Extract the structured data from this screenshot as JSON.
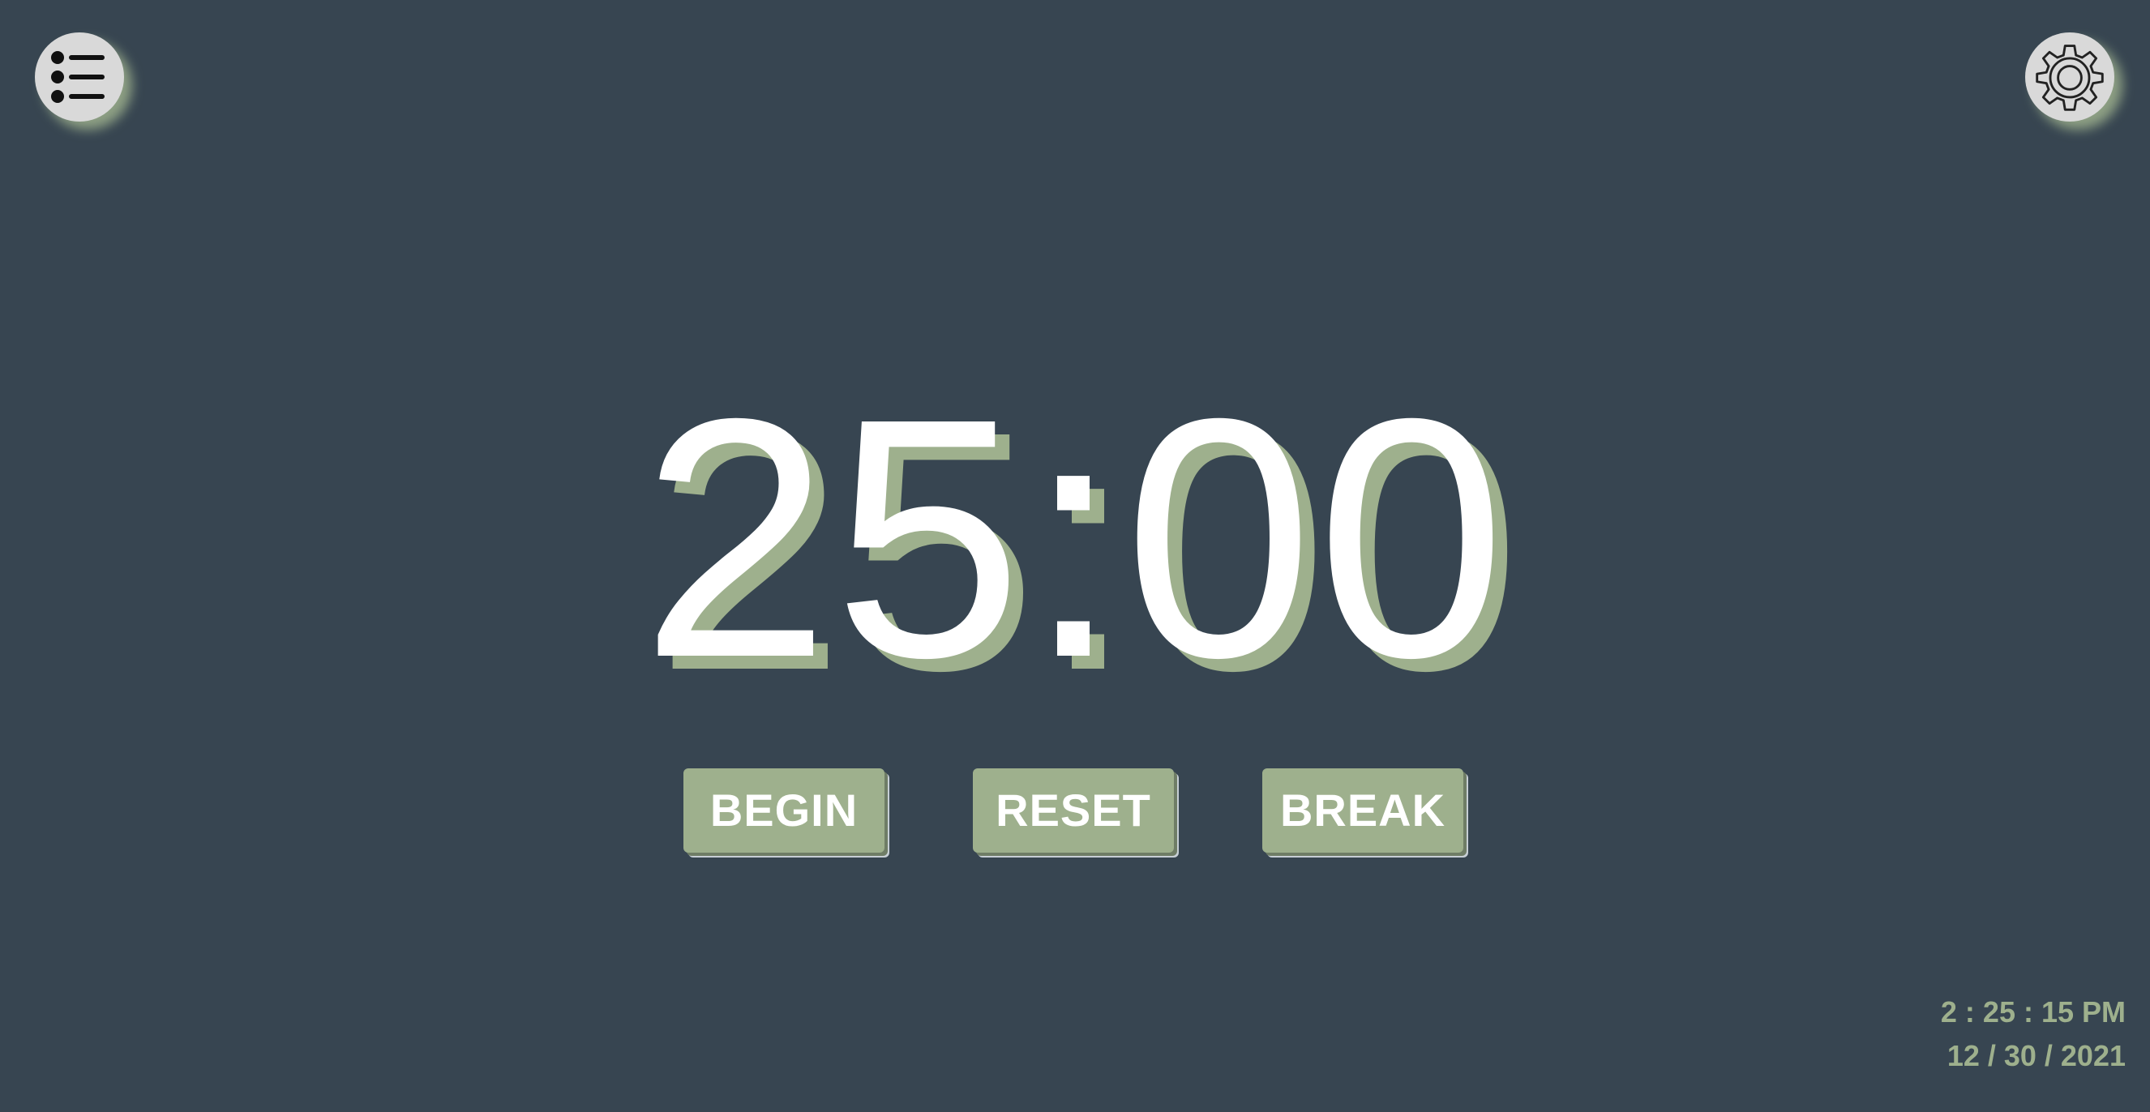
{
  "menu_button": {
    "icon": "list-icon"
  },
  "settings_button": {
    "icon": "gear-icon"
  },
  "timer": {
    "display": "25:00"
  },
  "controls": {
    "begin_label": "BEGIN",
    "reset_label": "RESET",
    "break_label": "BREAK"
  },
  "clock": {
    "time": "2 : 25 : 15 PM",
    "date": "12 / 30 / 2021"
  },
  "colors": {
    "background": "#374551",
    "accent": "#9eb08d",
    "text": "#ffffff",
    "icon_button": "#d9d9d9"
  }
}
